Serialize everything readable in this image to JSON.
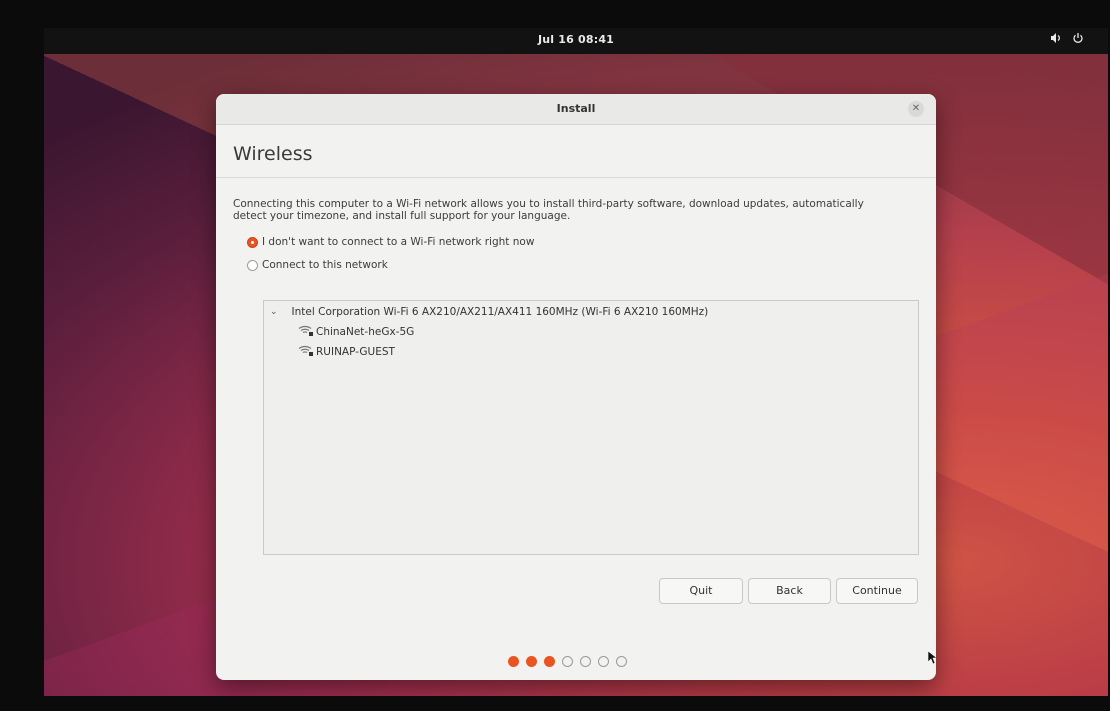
{
  "topbar": {
    "clock": "Jul 16 08:41"
  },
  "window": {
    "title": "Install"
  },
  "page": {
    "title": "Wireless",
    "description_line1": "Connecting this computer to a Wi-Fi network allows you to install third-party software, download updates, automatically",
    "description_line2": "detect your timezone, and install full support for your language."
  },
  "options": {
    "no_connect": {
      "label": "I don't want to connect to a Wi-Fi network right now",
      "selected": true
    },
    "connect": {
      "label": "Connect to this network",
      "selected": false
    }
  },
  "network_list": {
    "adapter": "Intel Corporation Wi-Fi 6 AX210/AX211/AX411 160MHz (Wi-Fi 6 AX210 160MHz)",
    "networks": [
      {
        "ssid": "ChinaNet-heGx-5G"
      },
      {
        "ssid": "RUINAP-GUEST"
      }
    ]
  },
  "buttons": {
    "quit": "Quit",
    "back": "Back",
    "continue": "Continue"
  },
  "progress": {
    "total_steps": 7,
    "completed_steps": 3
  },
  "colors": {
    "accent": "#e95420"
  },
  "icons": [
    "volume-icon",
    "power-icon",
    "close-icon",
    "chevron-down-icon",
    "wifi-secure-icon"
  ]
}
